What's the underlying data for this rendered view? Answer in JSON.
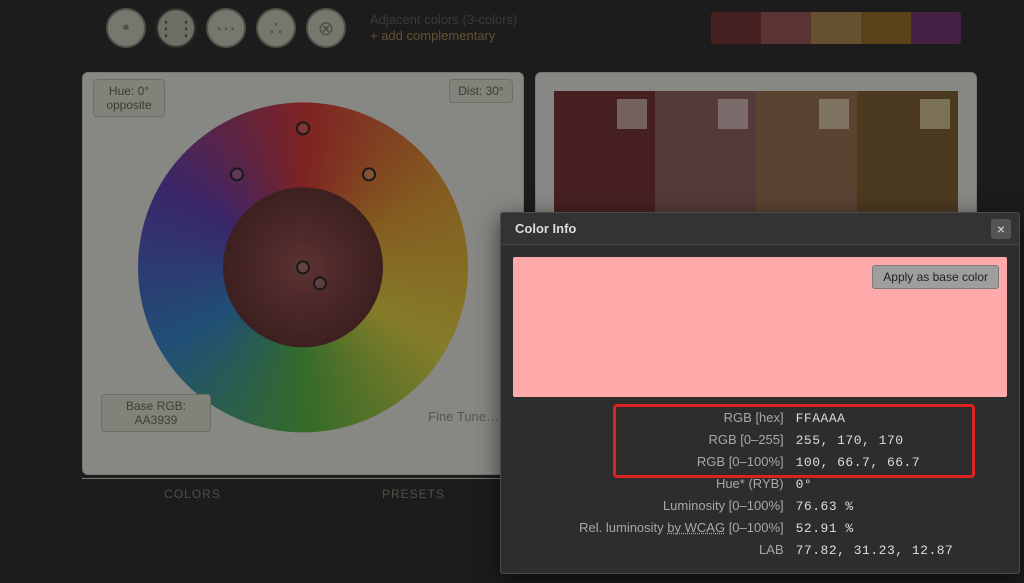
{
  "topbar": {
    "scheme_title": "Adjacent colors (3-colors)",
    "scheme_sub": "+   add complementary",
    "palette": [
      "#7d3a3a",
      "#a55d5d",
      "#b89357",
      "#a37a2e",
      "#7b3b7b"
    ]
  },
  "left": {
    "hue_label_1": "Hue: 0°",
    "hue_label_2": "opposite",
    "dist_label": "Dist: 30°",
    "base_label": "Base RGB:",
    "base_value": "AA3939",
    "fine_tune": "Fine Tune…",
    "tab_colors": "COLORS",
    "tab_presets": "PRESETS"
  },
  "popup": {
    "title": "Color Info",
    "apply": "Apply as base color",
    "swatch_hex": "#FFAAAA",
    "rows": [
      {
        "k": "RGB [hex]",
        "v": "FFAAAA",
        "boxed": true
      },
      {
        "k": "RGB [0–255]",
        "v": "255, 170, 170",
        "boxed": true
      },
      {
        "k": "RGB [0–100%]",
        "v": "100, 66.7, 66.7",
        "boxed": true
      },
      {
        "k": "Hue* (RYB)",
        "v": "0°",
        "boxed": false
      },
      {
        "k": "Luminosity [0–100%]",
        "v": "76.63 %",
        "boxed": false
      },
      {
        "k_html": "Rel. luminosity <span class='ul'>by WCAG</span> [0–100%]",
        "v": "52.91 %",
        "boxed": false
      },
      {
        "k": "LAB",
        "v": "77.82, 31.23, 12.87",
        "boxed": false
      }
    ]
  }
}
